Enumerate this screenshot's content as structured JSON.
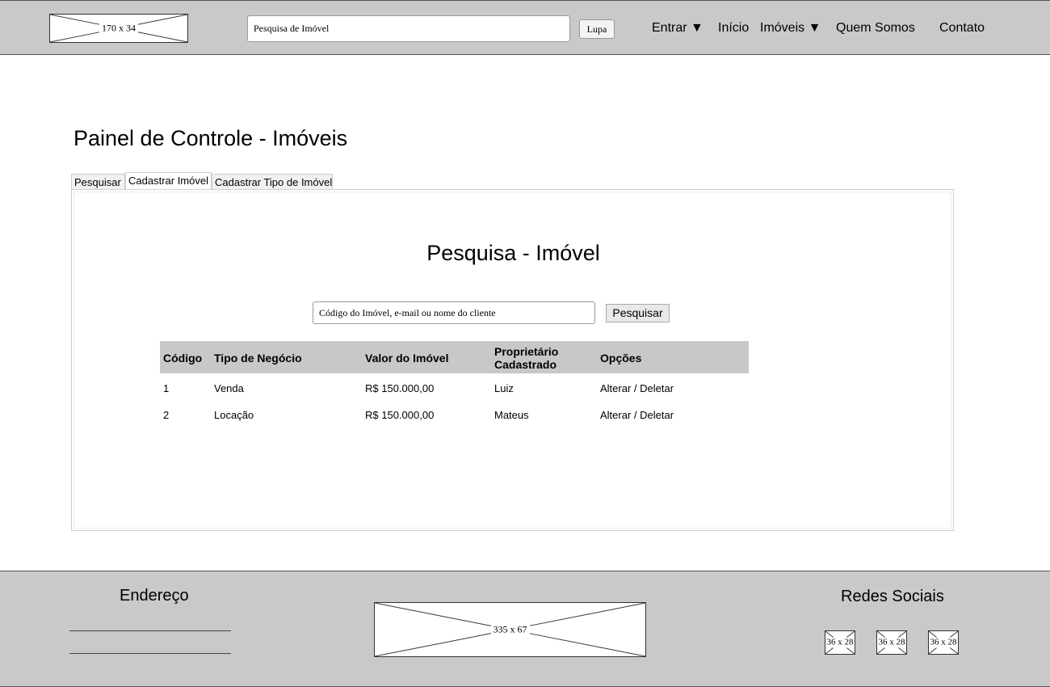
{
  "header": {
    "logo_label": "170 x 34",
    "search_value": "Pesquisa de Imóvel",
    "search_button": "Lupa",
    "nav": [
      {
        "label": "Entrar ▼"
      },
      {
        "label": "Início"
      },
      {
        "label": "Imóveis ▼"
      },
      {
        "label": "Quem Somos"
      },
      {
        "label": "Contato"
      }
    ]
  },
  "main": {
    "title": "Painel de Controle - Imóveis",
    "tabs": [
      {
        "label": "Pesquisar"
      },
      {
        "label": "Cadastrar Imóvel",
        "active": true
      },
      {
        "label": "Cadastrar Tipo de Imóvel"
      }
    ],
    "panel": {
      "title": "Pesquisa - Imóvel",
      "search_value": "Código do Imóvel, e-mail ou nome do cliente",
      "search_button": "Pesquisar",
      "table": {
        "headers": [
          "Código",
          "Tipo de Negócio",
          "Valor do Imóvel",
          "Proprietário\nCadastrado",
          "Opções"
        ],
        "header_lines": {
          "owner_line1": "Proprietário",
          "owner_line2": "Cadastrado"
        },
        "rows": [
          {
            "codigo": "1",
            "tipo": "Venda",
            "valor": "R$ 150.000,00",
            "proprietario": "Luiz",
            "opcoes": "Alterar / Deletar"
          },
          {
            "codigo": "2",
            "tipo": "Locação",
            "valor": "R$ 150.000,00",
            "proprietario": "Mateus",
            "opcoes": "Alterar / Deletar"
          }
        ]
      }
    }
  },
  "footer": {
    "address_heading": "Endereço",
    "banner_label": "335 x 67",
    "social_heading": "Redes Sociais",
    "social_icons": [
      {
        "label": "36 x 28"
      },
      {
        "label": "36 x 28"
      },
      {
        "label": "36 x 28"
      }
    ]
  },
  "colors": {
    "header_footer_bg": "#c9c9c9",
    "table_header_bg": "#c8c8c8"
  }
}
